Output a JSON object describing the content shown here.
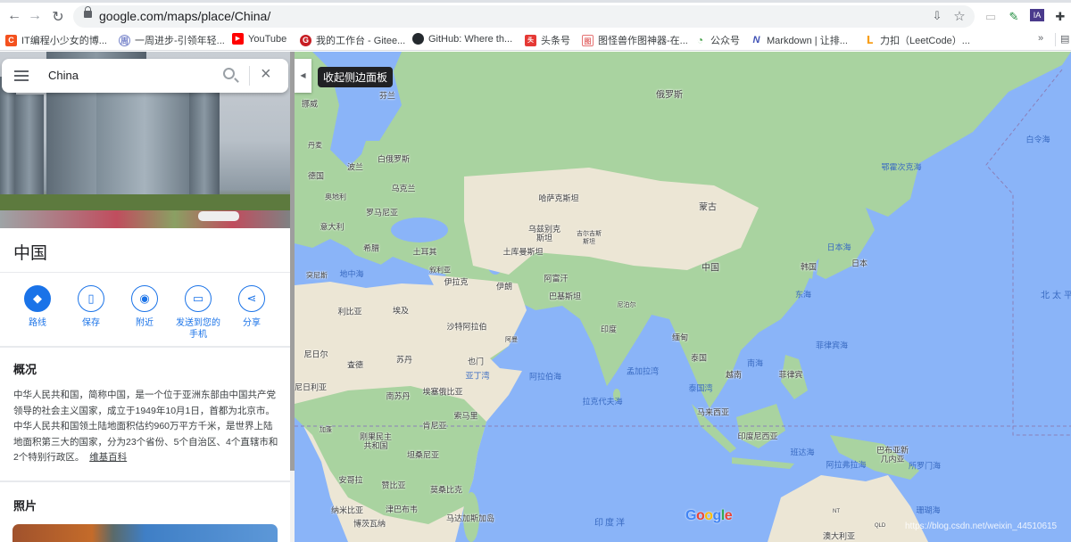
{
  "browser": {
    "url": "google.com/maps/place/China/",
    "bookmarks": [
      {
        "label": "IT编程小少女的博...",
        "icon": "csdn-icon",
        "color": "#f4511e",
        "glyph": "C"
      },
      {
        "label": "一周进步-引领年轻...",
        "icon": "zhou-icon",
        "color": "#7986cb",
        "glyph": "周"
      },
      {
        "label": "YouTube",
        "icon": "youtube-icon",
        "color": "#ff0000",
        "glyph": "▶"
      },
      {
        "label": "我的工作台 - Gitee...",
        "icon": "gitee-icon",
        "color": "#c71d23",
        "glyph": "G"
      },
      {
        "label": "GitHub: Where th...",
        "icon": "github-icon",
        "color": "#24292e",
        "glyph": "●"
      },
      {
        "label": "头条号",
        "icon": "toutiao-icon",
        "color": "#e53935",
        "glyph": "头"
      },
      {
        "label": "图怪兽作图神器-在...",
        "icon": "tuguaishou-icon",
        "color": "#e57373",
        "glyph": "图"
      },
      {
        "label": "公众号",
        "icon": "wechat-mp-icon",
        "color": "#43a047",
        "glyph": "◔"
      },
      {
        "label": "Markdown | 让排...",
        "icon": "markdown-icon",
        "color": "#3f51b5",
        "glyph": "N"
      },
      {
        "label": "力扣（LeetCode）...",
        "icon": "leetcode-icon",
        "color": "#f89f1b",
        "glyph": "L"
      }
    ],
    "more": "»"
  },
  "sidebar": {
    "search_value": "China",
    "place_title": "中国",
    "actions": [
      {
        "label": "路线",
        "icon": "directions-icon",
        "glyph": "◆"
      },
      {
        "label": "保存",
        "icon": "bookmark-icon",
        "glyph": "▯"
      },
      {
        "label": "附近",
        "icon": "nearby-icon",
        "glyph": "◉"
      },
      {
        "label": "发送到您的手机",
        "icon": "send-to-phone-icon",
        "glyph": "▭"
      },
      {
        "label": "分享",
        "icon": "share-icon",
        "glyph": "⋖"
      }
    ],
    "overview_heading": "概况",
    "overview_text": "中华人民共和国，简称中国，是一个位于亚洲东部由中国共产党领导的社会主义国家，成立于1949年10月1日，首都为北京市。中华人民共和国领土陆地面积估约960万平方千米，是世界上陆地面积第三大的国家，分为23个省份、5个自治区、4个直辖市和2个特别行政区。",
    "wiki_link": "维基百科",
    "photos_heading": "照片"
  },
  "map": {
    "collapse_tooltip": "收起侧边面板",
    "logo": "Google",
    "watermark": "https://blog.csdn.net/weixin_44510615",
    "labels": [
      "芬兰",
      "俄罗斯",
      "挪威",
      "丹麦",
      "白俄罗斯",
      "波兰",
      "德国",
      "乌克兰",
      "奥地利",
      "哈萨克斯坦",
      "罗马尼亚",
      "意大利",
      "希腊",
      "土耳其",
      "乌兹别克斯坦",
      "吉尔吉斯斯坦",
      "土库曼斯坦",
      "叙利亚",
      "地中海",
      "突尼斯",
      "伊拉克",
      "伊朗",
      "阿富汗",
      "巴基斯坦",
      "蒙古",
      "中国",
      "韩国",
      "日本",
      "日本海",
      "鄂霍次克海",
      "白令海",
      "北太平洋",
      "东海",
      "利比亚",
      "埃及",
      "沙特阿拉伯",
      "阿曼",
      "尼泊尔",
      "印度",
      "缅甸",
      "尼日尔",
      "查德",
      "苏丹",
      "也门",
      "亚丁湾",
      "阿拉伯海",
      "孟加拉湾",
      "泰国",
      "南海",
      "菲律宾海",
      "越南",
      "菲律宾",
      "泰国湾",
      "尼日利亚",
      "南苏丹",
      "埃塞俄比亚",
      "拉克代夫海",
      "索马里",
      "马来西亚",
      "肯尼亚",
      "加蓬",
      "刚果民主共和国",
      "印度尼西亚",
      "班达海",
      "巴布亚新几内亚",
      "坦桑尼亚",
      "阿拉弗拉海",
      "所罗门海",
      "安哥拉",
      "赞比亚",
      "莫桑比克",
      "纳米比亚",
      "津巴布韦",
      "马达加斯加岛",
      "博茨瓦纳",
      "印度洋",
      "珊瑚海",
      "NT",
      "QLD",
      "澳大利亚"
    ]
  }
}
